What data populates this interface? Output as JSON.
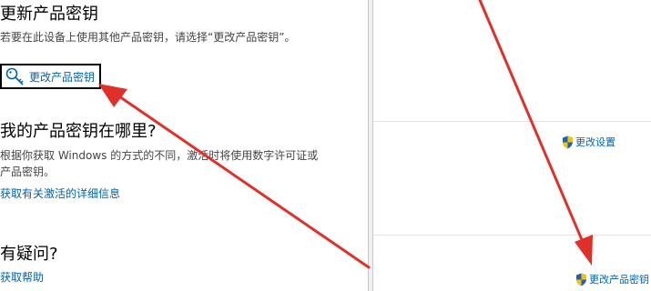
{
  "update_key": {
    "title": "更新产品密钥",
    "description": "若要在此设备上使用其他产品密钥，请选择“更改产品密钥”。",
    "button_label": "更改产品密钥"
  },
  "where_key": {
    "title": "我的产品密钥在哪里?",
    "description_line1": "根据你获取 Windows 的方式的不同，激活时将使用数字许可证或",
    "description_line2": "产品密钥。",
    "link": "获取有关激活的详细信息"
  },
  "questions": {
    "title": "有疑问?",
    "link": "获取帮助"
  },
  "right_panel": {
    "change_settings": "更改设置",
    "change_product_key": "更改产品密钥"
  },
  "colors": {
    "link": "#0063b1",
    "annotation_arrow": "#e0302a"
  }
}
